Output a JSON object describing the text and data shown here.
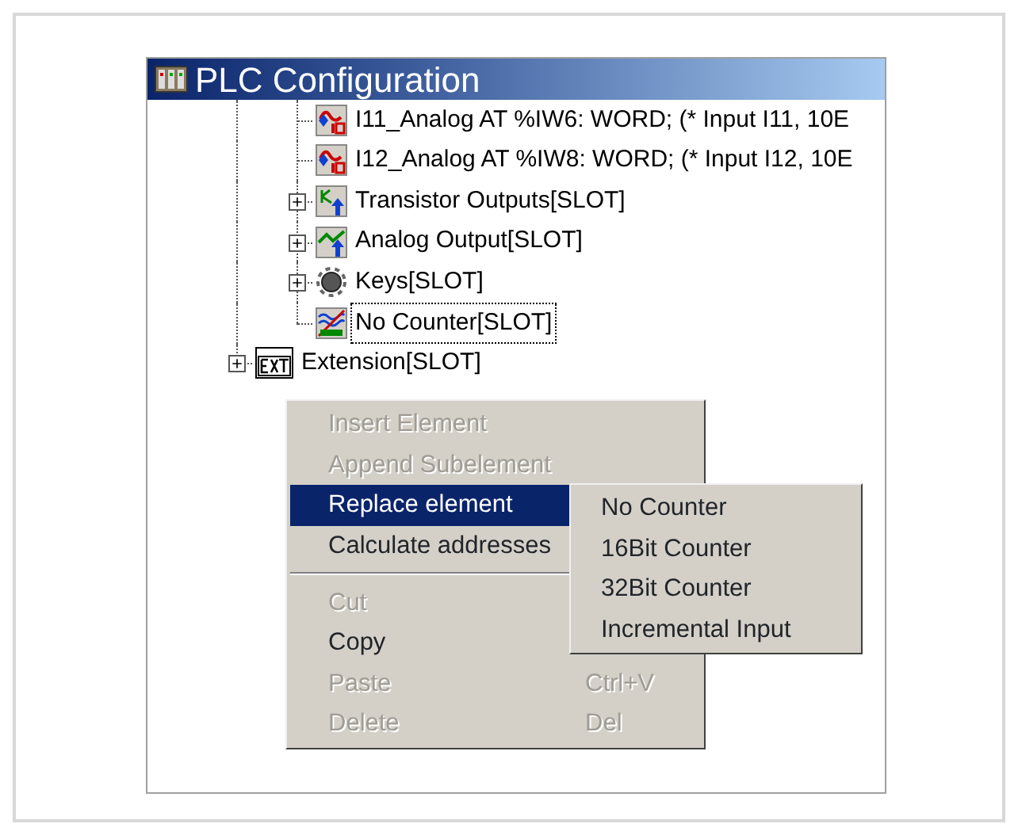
{
  "window": {
    "title": "PLC Configuration"
  },
  "tree": [
    {
      "children": [
        {
          "label": "I11_Analog AT %IW6: WORD; (* Input I11, 10E",
          "kind": "analog-input",
          "expandable": false,
          "selected": false
        },
        {
          "label": "I12_Analog AT %IW8: WORD; (* Input I12, 10E",
          "kind": "analog-input",
          "expandable": false,
          "selected": false
        },
        {
          "label": "Transistor Outputs[SLOT]",
          "kind": "transistor-output",
          "expandable": true,
          "selected": false
        },
        {
          "label": "Analog Output[SLOT]",
          "kind": "analog-output",
          "expandable": true,
          "selected": false
        },
        {
          "label": "Keys[SLOT]",
          "kind": "keys",
          "expandable": true,
          "selected": false
        },
        {
          "label": "No Counter[SLOT]",
          "kind": "counter",
          "expandable": false,
          "selected": true
        }
      ]
    },
    {
      "label": "Extension[SLOT]",
      "kind": "extension",
      "expandable": true,
      "selected": false
    }
  ],
  "context_menu": [
    {
      "kind": "item",
      "label": "Insert Element",
      "disabled": true,
      "selected": false
    },
    {
      "kind": "item",
      "label": "Append Subelement",
      "disabled": true,
      "selected": false
    },
    {
      "kind": "item",
      "label": "Replace element",
      "disabled": false,
      "selected": true
    },
    {
      "kind": "item",
      "label": "Calculate addresses",
      "disabled": false,
      "selected": false
    },
    {
      "kind": "separator"
    },
    {
      "kind": "item",
      "label": "Cut",
      "disabled": true,
      "selected": false
    },
    {
      "kind": "item",
      "label": "Copy",
      "disabled": false,
      "selected": false
    },
    {
      "kind": "item",
      "label": "Paste",
      "shortcut": "Ctrl+V",
      "disabled": true,
      "selected": false
    },
    {
      "kind": "item",
      "label": "Delete",
      "shortcut": "Del",
      "disabled": true,
      "selected": false
    }
  ],
  "submenu": [
    {
      "label": "No Counter",
      "selected": false
    },
    {
      "label": "16Bit Counter",
      "selected": false
    },
    {
      "label": "32Bit Counter",
      "selected": false
    },
    {
      "label": "Incremental Input",
      "selected": false
    }
  ]
}
